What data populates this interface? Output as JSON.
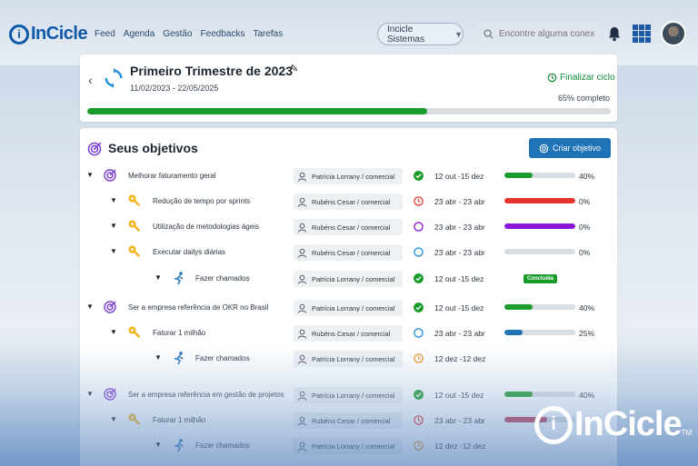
{
  "app": {
    "logo_text": "InCicle",
    "logo_letter": "i"
  },
  "nav": {
    "items": [
      "Feed",
      "Agenda",
      "Gestão",
      "Feedbacks",
      "Tarefas"
    ]
  },
  "company_select": {
    "value": "Incicle Sistemas"
  },
  "search": {
    "placeholder": "Encontre alguma conexão"
  },
  "cycle": {
    "title": "Primeiro Trimestre de 2023",
    "dates": "11/02/2023 - 22/05/2025",
    "finalize_label": "Finalizar ciclo",
    "completion_label": "65% completo",
    "completion": 0.65,
    "bar_color": "#1a9c2a"
  },
  "objectives": {
    "heading": "Seus objetivos",
    "create_label": "Criar objetivo",
    "rows": [
      {
        "level": 0,
        "icon": "target-icon",
        "name": "Melhorar faturamento geral",
        "owner": "Patrícia Lorrany / comercial",
        "status": "done",
        "period": "12 out -15 dez",
        "progress": 40,
        "progress_label": "40%",
        "color": "#1a9c2a"
      },
      {
        "level": 1,
        "icon": "key-icon",
        "name": "Redução de tempo por sprints",
        "owner": "Rubéns Cesar / comercial",
        "status": "late",
        "period": "23 abr - 23 abr",
        "progress": 100,
        "progress_label": "0%",
        "color": "#e8352b"
      },
      {
        "level": 1,
        "icon": "key-icon",
        "name": "Utilização de metodologias ágeis",
        "owner": "Rubéns Cesar / comercial",
        "status": "purple",
        "period": "23 abr - 23 abr",
        "progress": 100,
        "progress_label": "0%",
        "color": "#8a17d8"
      },
      {
        "level": 1,
        "icon": "key-icon",
        "name": "Executar dailys diárias",
        "owner": "Rubéns Cesar / comercial",
        "status": "open",
        "period": "23 abr - 23 abr",
        "progress": 0,
        "progress_label": "0%",
        "color": "#1f73b7"
      },
      {
        "level": 2,
        "icon": "runner-icon",
        "name": "Fazer chamados",
        "owner": "Patrícia Lorrany / comercial",
        "status": "done",
        "period": "12 out -15 dez",
        "badge": "Concluída",
        "color": "#1a9c2a"
      },
      {
        "level": 0,
        "icon": "target-icon",
        "name": "Ser a empresa referência de OKR no Brasil",
        "owner": "Patrícia Lorrany / comercial",
        "status": "done",
        "period": "12 out -15 dez",
        "progress": 40,
        "progress_label": "40%",
        "color": "#1a9c2a"
      },
      {
        "level": 1,
        "icon": "key-icon",
        "name": "Faturar 1 milhão",
        "owner": "Rubéns Cesar / comercial",
        "status": "open",
        "period": "23 abr - 23 abr",
        "progress": 25,
        "progress_label": "25%",
        "color": "#1f73b7"
      },
      {
        "level": 2,
        "icon": "runner-icon",
        "name": "Fazer chamados",
        "owner": "Patrícia Lorrany / comercial",
        "status": "pending",
        "period": "12 dez -12 dez",
        "color": "#e89520"
      },
      {
        "level": 0,
        "icon": "target-icon",
        "name": "Ser a empresa referência em gestão de projetos",
        "owner": "Patrícia Lorrany / comercial",
        "status": "done",
        "period": "12 out -15 dez",
        "progress": 40,
        "progress_label": "40%",
        "color": "#1a9c2a"
      },
      {
        "level": 1,
        "icon": "key-icon",
        "name": "Faturar 1 milhão",
        "owner": "Rubéns Cesar / comercial",
        "status": "late",
        "period": "23 abr - 23 abr",
        "progress": 60,
        "progress_label": "",
        "color": "#c0405a"
      },
      {
        "level": 2,
        "icon": "runner-icon",
        "name": "Fazer chamados",
        "owner": "Patrícia Lorrany / comercial",
        "status": "pending",
        "period": "12 dez -12 dez",
        "color": "#e89520"
      }
    ]
  },
  "watermark": {
    "text": "InCicle",
    "trademark": "TM"
  }
}
